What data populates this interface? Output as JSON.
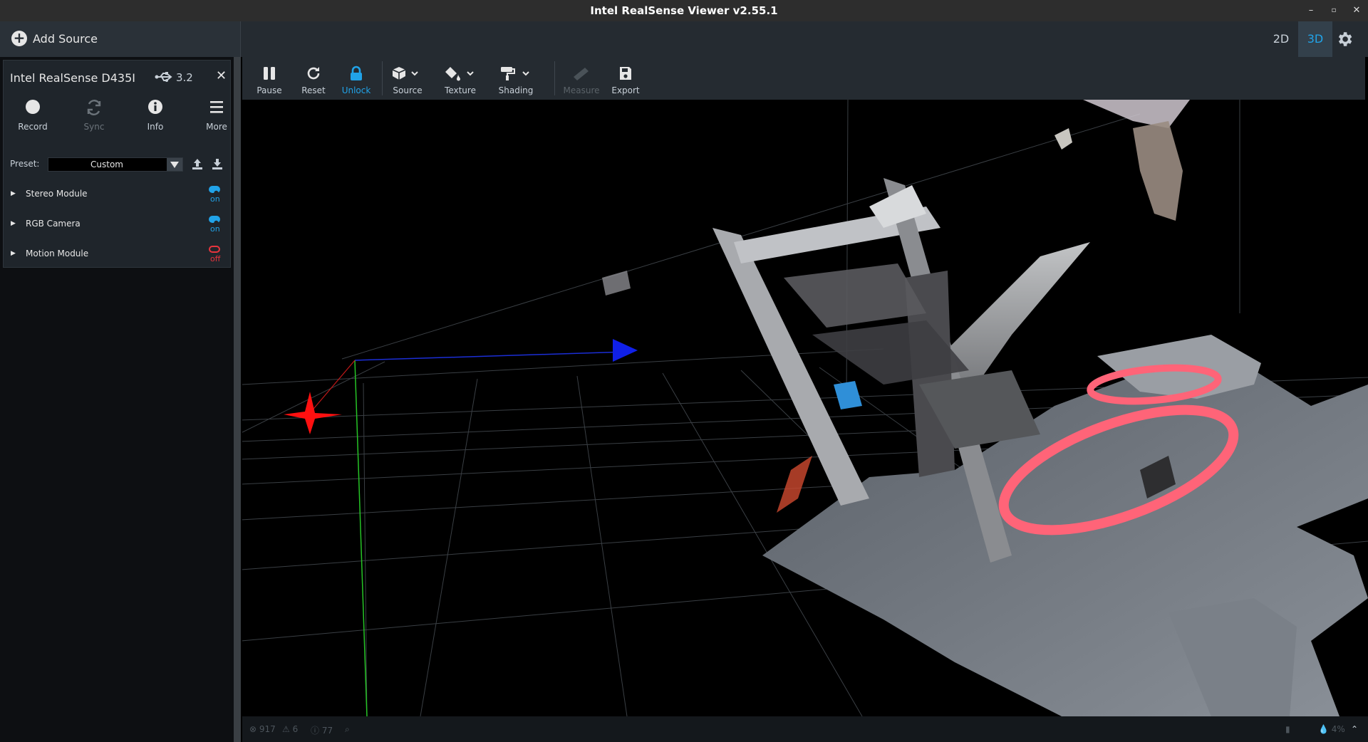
{
  "window": {
    "title": "Intel RealSense Viewer v2.55.1"
  },
  "header": {
    "add_source_label": "Add Source",
    "view_2d": "2D",
    "view_3d": "3D"
  },
  "device": {
    "name": "Intel RealSense D435I",
    "usb_version": "3.2",
    "buttons": [
      {
        "label": "Record",
        "icon": "record-icon"
      },
      {
        "label": "Sync",
        "icon": "sync-icon"
      },
      {
        "label": "Info",
        "icon": "info-icon"
      },
      {
        "label": "More",
        "icon": "menu-icon"
      }
    ],
    "preset_label": "Preset:",
    "preset_value": "Custom",
    "modules": [
      {
        "name": "Stereo Module",
        "state": "on"
      },
      {
        "name": "RGB Camera",
        "state": "on"
      },
      {
        "name": "Motion Module",
        "state": "off"
      }
    ]
  },
  "toolbar": {
    "pause": "Pause",
    "reset": "Reset",
    "unlock": "Unlock",
    "source": "Source",
    "texture": "Texture",
    "shading": "Shading",
    "measure": "Measure",
    "export": "Export"
  },
  "statusbar": {
    "errors": "917",
    "warnings": "6",
    "info": "77",
    "cpu": "4%"
  },
  "colors": {
    "accent": "#21a3e8",
    "off": "#e8343d",
    "panel": "#1f252b",
    "toolbar": "#252b31"
  }
}
